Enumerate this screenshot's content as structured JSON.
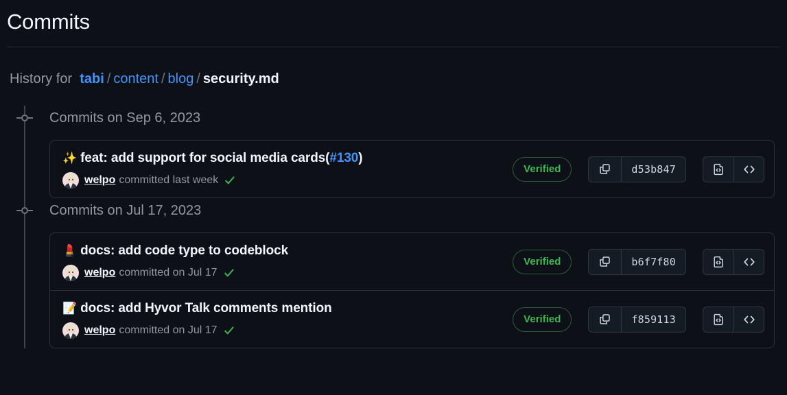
{
  "page": {
    "title": "Commits"
  },
  "breadcrumb": {
    "prefix": "History for",
    "sep": "/",
    "repo": "tabi",
    "dir1": "content",
    "dir2": "blog",
    "current": "security.md"
  },
  "colors": {
    "page_background": "#0d1117",
    "card_background": "#0d1117",
    "border": "#2a313c",
    "link_blue": "#4493f8",
    "verified_green": "#3fb950",
    "muted_text": "#9198a1",
    "primary_text": "#f0f6fc",
    "rail": "#3d444d",
    "button_background": "#151b23"
  },
  "groups": [
    {
      "marker_icon": "timeline-dot-icon",
      "heading": "Commits on Sep 6, 2023",
      "commits": [
        {
          "emoji": "✨",
          "emoji_name": "sparkles-emoji",
          "message": "feat: add support for social media cards",
          "pr_open_paren": "(",
          "pr_ref": "#130",
          "pr_close_paren": ")",
          "avatar_name": "welpo-avatar",
          "author": "welpo",
          "committed_text": "committed last week",
          "check_icon": "green-check-icon",
          "verified_label": "Verified",
          "copy_icon": "copy-icon",
          "sha": "d53b847",
          "browse_icon": "file-code-icon",
          "code_icon": "code-brackets-icon"
        }
      ]
    },
    {
      "marker_icon": "timeline-dot-icon",
      "heading": "Commits on Jul 17, 2023",
      "commits": [
        {
          "emoji": "💄",
          "emoji_name": "lipstick-emoji",
          "message": "docs: add code type to codeblock",
          "pr_open_paren": "",
          "pr_ref": "",
          "pr_close_paren": "",
          "avatar_name": "welpo-avatar",
          "author": "welpo",
          "committed_text": "committed on Jul 17",
          "check_icon": "green-check-icon",
          "verified_label": "Verified",
          "copy_icon": "copy-icon",
          "sha": "b6f7f80",
          "browse_icon": "file-code-icon",
          "code_icon": "code-brackets-icon"
        },
        {
          "emoji": "📝",
          "emoji_name": "memo-emoji",
          "message": "docs: add Hyvor Talk comments mention",
          "pr_open_paren": "",
          "pr_ref": "",
          "pr_close_paren": "",
          "avatar_name": "welpo-avatar",
          "author": "welpo",
          "committed_text": "committed on Jul 17",
          "check_icon": "green-check-icon",
          "verified_label": "Verified",
          "copy_icon": "copy-icon",
          "sha": "f859113",
          "browse_icon": "file-code-icon",
          "code_icon": "code-brackets-icon"
        }
      ]
    }
  ]
}
